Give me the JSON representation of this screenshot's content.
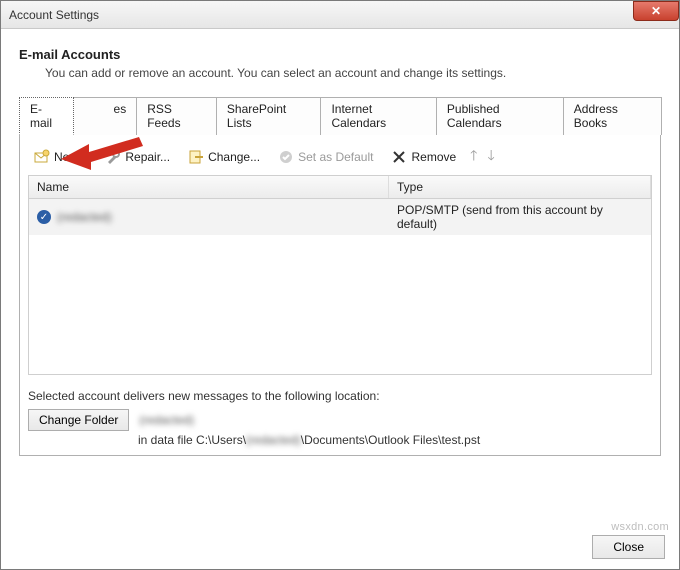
{
  "window": {
    "title": "Account Settings",
    "close_glyph": "✕"
  },
  "header": {
    "title": "E-mail Accounts",
    "subtitle": "You can add or remove an account. You can select an account and change its settings."
  },
  "tabs": [
    {
      "label": "E-mail",
      "active": true
    },
    {
      "label": "es"
    },
    {
      "label": "RSS Feeds"
    },
    {
      "label": "SharePoint Lists"
    },
    {
      "label": "Internet Calendars"
    },
    {
      "label": "Published Calendars"
    },
    {
      "label": "Address Books"
    }
  ],
  "toolbar": {
    "new": "New...",
    "repair": "Repair...",
    "change": "Change...",
    "set_default": "Set as Default",
    "remove": "Remove"
  },
  "list": {
    "col_name": "Name",
    "col_type": "Type",
    "rows": [
      {
        "name": "(redacted)",
        "type": "POP/SMTP (send from this account by default)"
      }
    ]
  },
  "delivery": {
    "label": "Selected account delivers new messages to the following location:",
    "change_folder": "Change Folder",
    "folder_name": "(redacted)",
    "path_prefix": "in data file C:\\Users\\",
    "path_user": "(redacted)",
    "path_suffix": "\\Documents\\Outlook Files\\test.pst"
  },
  "footer": {
    "close": "Close"
  },
  "watermark": "wsxdn.com"
}
